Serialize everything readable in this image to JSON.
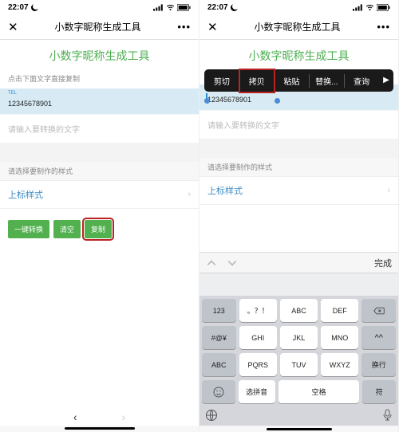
{
  "status": {
    "time": "22:07",
    "sig": "sig",
    "wifi": "wifi",
    "bat": "bat"
  },
  "nav": {
    "close": "✕",
    "title": "小数字昵称生成工具",
    "more": "•••"
  },
  "hero": "小数字昵称生成工具",
  "hint": "点击下面文字直接复制",
  "selection": {
    "label": "TEL",
    "value": "12345678901"
  },
  "input_placeholder": "请输入要转换的文字",
  "style_section": "请选择要制作的样式",
  "picker": {
    "label": "上标样式",
    "chev": "›"
  },
  "buttons": {
    "convert": "一键转换",
    "clear": "清空",
    "copy": "复制"
  },
  "bottom": {
    "back": "‹",
    "fwd": "›"
  },
  "popover": {
    "cut": "剪切",
    "copy": "拷贝",
    "paste": "粘贴",
    "replace": "替换...",
    "search": "查询",
    "arrow": "▶"
  },
  "kb": {
    "done": "完成",
    "r1": {
      "k1": "123",
      "k2": "。？！",
      "k3": "ABC",
      "k4": "DEF"
    },
    "r2": {
      "k1": "#@¥",
      "k2": "GHI",
      "k3": "JKL",
      "k4": "MNO"
    },
    "r3": {
      "k1": "ABC",
      "k2": "PQRS",
      "k3": "TUV",
      "k4": "WXYZ"
    },
    "r4": {
      "pin": "选拼音",
      "space": "空格",
      "enter": "换行"
    },
    "sym": "符"
  }
}
